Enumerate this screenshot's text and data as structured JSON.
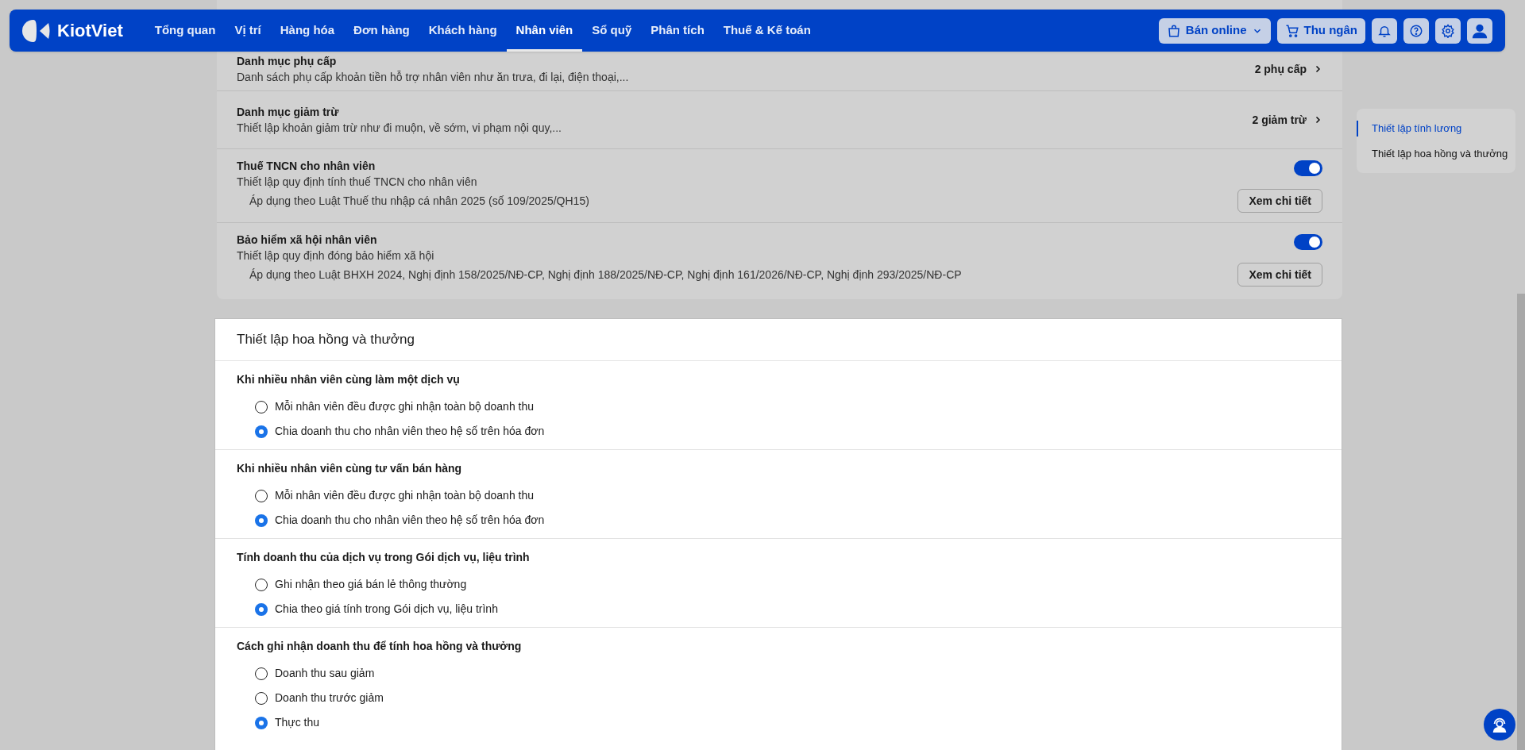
{
  "header": {
    "logo": "KiotViet",
    "nav": [
      {
        "label": "Tổng quan",
        "selected": false
      },
      {
        "label": "Vị trí",
        "selected": false
      },
      {
        "label": "Hàng hóa",
        "selected": false
      },
      {
        "label": "Đơn hàng",
        "selected": false
      },
      {
        "label": "Khách hàng",
        "selected": false
      },
      {
        "label": "Nhân viên",
        "selected": true
      },
      {
        "label": "Sổ quỹ",
        "selected": false
      },
      {
        "label": "Phân tích",
        "selected": false
      },
      {
        "label": "Thuế & Kế toán",
        "selected": false
      }
    ],
    "online_button": "Bán online",
    "cashier_button": "Thu ngân"
  },
  "salary_rows": [
    {
      "kind": "link",
      "title": "Danh mục phụ cấp",
      "description": "Danh sách phụ cấp khoản tiền hỗ trợ nhân viên như ăn trưa, đi lại, điện thoại,...",
      "value": "2 phụ cấp"
    },
    {
      "kind": "link",
      "title": "Danh mục giảm trừ",
      "description": "Thiết lập khoản giảm trừ như đi muộn, về sớm, vi phạm nội quy,...",
      "value": "2 giảm trừ"
    },
    {
      "kind": "toggle",
      "title": "Thuế TNCN cho nhân viên",
      "description": "Thiết lập quy định tính thuế TNCN cho nhân viên",
      "on": true,
      "note": "Áp dụng theo Luật Thuế thu nhập cá nhân 2025 (số 109/2025/QH15)",
      "button": "Xem chi tiết"
    },
    {
      "kind": "toggle",
      "title": "Bảo hiểm xã hội nhân viên",
      "description": "Thiết lập quy định đóng bảo hiểm xã hội",
      "on": true,
      "note": "Áp dụng theo Luật BHXH 2024, Nghị định 158/2025/NĐ-CP, Nghị định 188/2025/NĐ-CP, Nghị định 161/2026/NĐ-CP, Nghị định 293/2025/NĐ-CP",
      "button": "Xem chi tiết"
    }
  ],
  "commission": {
    "title": "Thiết lập hoa hồng và thưởng",
    "groups": [
      {
        "title": "Khi nhiều nhân viên cùng làm một dịch vụ",
        "options": [
          {
            "label": "Mỗi nhân viên đều được ghi nhận toàn bộ doanh thu",
            "selected": false
          },
          {
            "label": "Chia doanh thu cho nhân viên theo hệ số trên hóa đơn",
            "selected": true
          }
        ]
      },
      {
        "title": "Khi nhiều nhân viên cùng tư vấn bán hàng",
        "options": [
          {
            "label": "Mỗi nhân viên đều được ghi nhận toàn bộ doanh thu",
            "selected": false
          },
          {
            "label": "Chia doanh thu cho nhân viên theo hệ số trên hóa đơn",
            "selected": true
          }
        ]
      },
      {
        "title": "Tính doanh thu của dịch vụ trong Gói dịch vụ, liệu trình",
        "options": [
          {
            "label": "Ghi nhận theo giá bán lẻ thông thường",
            "selected": false
          },
          {
            "label": "Chia theo giá tính trong Gói dịch vụ, liệu trình",
            "selected": true
          }
        ]
      },
      {
        "title": "Cách ghi nhận doanh thu để tính hoa hồng và thưởng",
        "options": [
          {
            "label": "Doanh thu sau giảm",
            "selected": false
          },
          {
            "label": "Doanh thu trước giảm",
            "selected": false
          },
          {
            "label": "Thực thu",
            "selected": true
          }
        ]
      }
    ]
  },
  "side_nav": [
    {
      "label": "Thiết lập tính lương",
      "selected": true
    },
    {
      "label": "Thiết lập hoa hồng và thưởng",
      "selected": false
    }
  ]
}
